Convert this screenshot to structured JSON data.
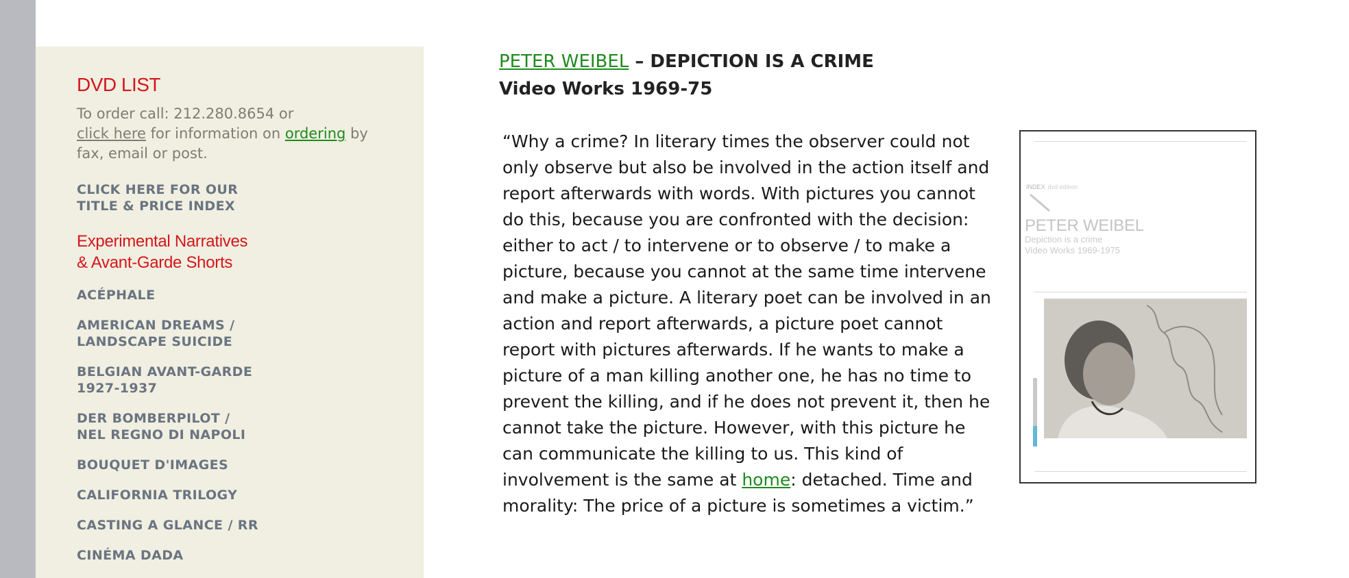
{
  "sidebar": {
    "heading": "DVD LIST",
    "order": {
      "prefix": "To order call: 212.280.8654 or",
      "click_here": "click here",
      "middle": " for information on ",
      "ordering": "ordering",
      "suffix": " by fax, email or post."
    },
    "index_line1": "CLICK HERE FOR OUR",
    "index_line2": "TITLE & PRICE INDEX",
    "category_line1": "Experimental Narratives",
    "category_line2": "& Avant-Garde Shorts",
    "titles": [
      {
        "line1": "ACÉPHALE",
        "line2": ""
      },
      {
        "line1": "AMERICAN DREAMS /",
        "line2": "LANDSCAPE SUICIDE"
      },
      {
        "line1": "BELGIAN AVANT-GARDE",
        "line2": "1927-1937"
      },
      {
        "line1": "DER BOMBERPILOT /",
        "line2": "NEL REGNO DI NAPOLI"
      },
      {
        "line1": "BOUQUET D'IMAGES",
        "line2": ""
      },
      {
        "line1": "CALIFORNIA TRILOGY",
        "line2": ""
      },
      {
        "line1": "CASTING A GLANCE / RR",
        "line2": ""
      },
      {
        "line1": "CINÉMA DADA",
        "line2": ""
      }
    ]
  },
  "main": {
    "artist": "PETER WEIBEL",
    "title_rest": " – DEPICTION IS A CRIME",
    "subtitle": "Video Works 1969-75",
    "quote_before": "“Why a crime? In literary times the observer could not only observe but also be involved in the action itself and report afterwards with words. With pictures you cannot do this, because you are confronted with the decision: either to act / to intervene or to observe / to make a picture, because you cannot at the same time intervene and make a picture. A literary poet can be involved in an action and report afterwards, a picture poet cannot report with pictures afterwards. If he wants to make a picture of a man killing another one, he has no time to prevent the killing, and if he does not prevent it, then he cannot take the picture. However, with this picture he can communicate the killing to us. This kind of involvement is the same at ",
    "quote_link": "home",
    "quote_after": ": detached. Time and morality: The price of a picture is sometimes a victim.”"
  },
  "cover": {
    "index_label": "INDEX",
    "index_sub": "dvd edition",
    "artist": "PETER WEIBEL",
    "line1": "Depiction is a crime",
    "line2": "Video Works 1969-1975"
  },
  "colors": {
    "sidebar_bg": "#f0efe1",
    "accent_red": "#d4161c",
    "link_green": "#1e8a1e",
    "nav_gray": "#6a7481"
  }
}
